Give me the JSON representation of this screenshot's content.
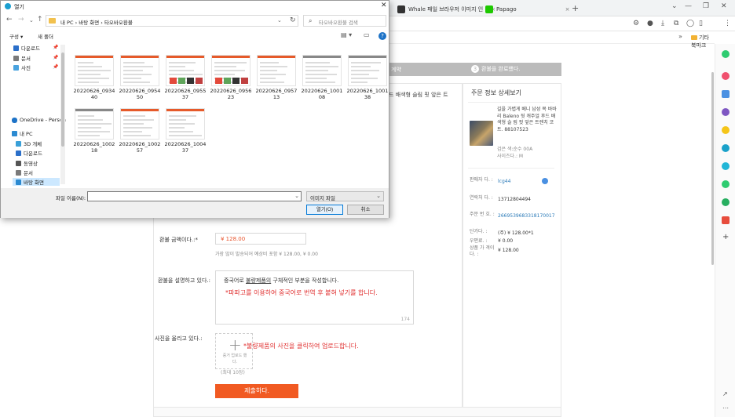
{
  "browser": {
    "tabs": [
      {
        "label": "Whale 패일 브라우저 이미지 인",
        "icon_color": "#333333"
      },
      {
        "label": "Papago",
        "icon_color": "#1ec800"
      }
    ],
    "bookmark_folder": "기타 북마크",
    "chevron": "»"
  },
  "dialog": {
    "title": "열기",
    "path": "내 PC  ›  바탕 화면  ›  타오바오환불",
    "search_placeholder": "타오바오환불 검색",
    "toolbar": {
      "organize": "구성 ▾",
      "new_folder": "새 폴더"
    },
    "nav_items": [
      {
        "label": "다운로드",
        "pinned": true,
        "icon_color": "#2b6fc9"
      },
      {
        "label": "문서",
        "pinned": true,
        "icon_color": "#7a7a7a"
      },
      {
        "label": "사진",
        "pinned": true,
        "icon_color": "#4aa3df"
      },
      {
        "label": "OneDrive - Person",
        "pinned": false,
        "icon_color": "#1e73c7"
      },
      {
        "label": "내 PC",
        "pinned": false,
        "icon_color": "#2b8ad1"
      },
      {
        "label": "3D 개체",
        "pinned": false,
        "icon_color": "#3aa0d8"
      },
      {
        "label": "다운로드",
        "pinned": false,
        "icon_color": "#2b6fc9"
      },
      {
        "label": "동영상",
        "pinned": false,
        "icon_color": "#555555"
      },
      {
        "label": "문서",
        "pinned": false,
        "icon_color": "#7a7a7a"
      },
      {
        "label": "바탕 화면",
        "pinned": false,
        "icon_color": "#2b8ad1"
      }
    ],
    "files": [
      {
        "name": "20220626_093440",
        "accent": "#e65a2a"
      },
      {
        "name": "20220626_095450",
        "accent": "#e65a2a"
      },
      {
        "name": "20220626_095537",
        "accent": "#e65a2a"
      },
      {
        "name": "20220626_095623",
        "accent": "#e65a2a"
      },
      {
        "name": "20220626_095713",
        "accent": "#e65a2a"
      },
      {
        "name": "20220626_100108",
        "accent": "#888888"
      },
      {
        "name": "20220626_100138",
        "accent": "#888888"
      },
      {
        "name": "20220626_100218",
        "accent": "#888888"
      },
      {
        "name": "20220626_100257",
        "accent": "#e65a2a"
      },
      {
        "name": "20220626_100437",
        "accent": "#e65a2a"
      }
    ],
    "filename_label": "파일 이름(N):",
    "filename_value": "",
    "filetype": "이미지 파일",
    "open_button": "열기(O)",
    "cancel_button": "취소"
  },
  "page": {
    "step_partial": "계약",
    "step3_number": "3",
    "step3_label": "환불을 완료했다.",
    "product_desc_partial": "드 배색형 슬림 핏 앞은 트",
    "refund_label": "환불 금액이다.:*",
    "refund_value": "¥ 128.00",
    "refund_hint": "가장 많이 발송되어 예상비 포함 ¥ 128.00, ¥ 0.00",
    "reason_label": "환불을 설명하고 있다.:",
    "reason_placeholder_pre": "중국어로 ",
    "reason_placeholder_u": "불량제품의",
    "reason_placeholder_post": " 구체적인 부분을 작성합니다.",
    "reason_red": "*파파고를 이용하여 중국어로 번역 후 붙혀 넣기를 합니다.",
    "reason_count": "174",
    "photo_label": "사진을 올리고 있다.:",
    "upload_text_line1": "증거 업로드 했",
    "upload_text_line2": "다.",
    "upload_limit": "(최대 10장)",
    "upload_red": "*불량제품의 사진을 클릭하여 업로드합니다.",
    "submit": "제출하다."
  },
  "side": {
    "title": "주문 정보 상세보기",
    "product_name": "길을 가볍게 베니 남성 복 바바리 Baleno 뒷 캐주얼 후드 배색형 슬 림 핏 앞은 트렌치 코 트. 88107523",
    "option_line1": "검은 색:순수 00A",
    "option_line2": "사이즈다.: M",
    "rows": [
      {
        "k": "판매자 다.   :",
        "v": "lcg44",
        "link": true
      },
      {
        "k": "연락처 다.   :",
        "v": "13712804494",
        "link": false
      },
      {
        "k": "주문 번 호.  :",
        "v": "2669539683318170017",
        "link": true
      },
      {
        "k": "단가다.  :",
        "v": "(주) ¥ 128.00*1",
        "link": false
      },
      {
        "k": "우편료.  :",
        "v": "¥ 0.00",
        "link": false
      },
      {
        "k": "상품 가 격이다.  :",
        "v": "¥ 128.00",
        "link": false
      }
    ]
  },
  "colors": {
    "accent_orange": "#f15a22",
    "warn_red": "#e03030",
    "link_blue": "#2a7ab8"
  }
}
